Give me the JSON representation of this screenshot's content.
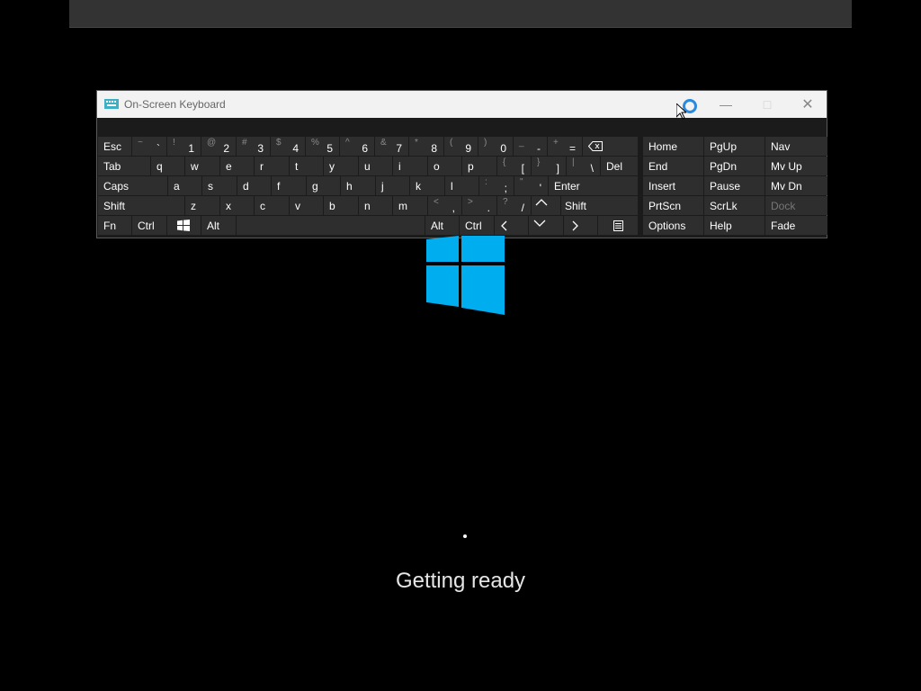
{
  "window": {
    "title": "On-Screen Keyboard",
    "controls": {
      "minimize": "minimize",
      "maximize": "maximize",
      "close": "close"
    }
  },
  "keyboard": {
    "row1": {
      "esc": "Esc",
      "digits": [
        {
          "shift": "~",
          "key": "`"
        },
        {
          "shift": "!",
          "key": "1"
        },
        {
          "shift": "@",
          "key": "2"
        },
        {
          "shift": "#",
          "key": "3"
        },
        {
          "shift": "$",
          "key": "4"
        },
        {
          "shift": "%",
          "key": "5"
        },
        {
          "shift": "^",
          "key": "6"
        },
        {
          "shift": "&",
          "key": "7"
        },
        {
          "shift": "*",
          "key": "8"
        },
        {
          "shift": "(",
          "key": "9"
        },
        {
          "shift": ")",
          "key": "0"
        },
        {
          "shift": "_",
          "key": "-"
        },
        {
          "shift": "+",
          "key": "="
        }
      ]
    },
    "row2": {
      "tab": "Tab",
      "letters": [
        "q",
        "w",
        "e",
        "r",
        "t",
        "y",
        "u",
        "i",
        "o",
        "p"
      ],
      "brackets": [
        {
          "shift": "{",
          "key": "["
        },
        {
          "shift": "}",
          "key": "]"
        },
        {
          "shift": "|",
          "key": "\\"
        }
      ],
      "del": "Del"
    },
    "row3": {
      "caps": "Caps",
      "letters": [
        "a",
        "s",
        "d",
        "f",
        "g",
        "h",
        "j",
        "k",
        "l"
      ],
      "punct": [
        {
          "shift": ":",
          "key": ";"
        },
        {
          "shift": "\"",
          "key": "'"
        }
      ],
      "enter": "Enter"
    },
    "row4": {
      "shift_left": "Shift",
      "letters": [
        "z",
        "x",
        "c",
        "v",
        "b",
        "n",
        "m"
      ],
      "punct": [
        {
          "shift": "<",
          "key": ","
        },
        {
          "shift": ">",
          "key": "."
        },
        {
          "shift": "?",
          "key": "/"
        }
      ],
      "shift_right": "Shift"
    },
    "row5": {
      "fn": "Fn",
      "ctrl_left": "Ctrl",
      "alt_left": "Alt",
      "alt_right": "Alt",
      "ctrl_right": "Ctrl"
    },
    "nav": {
      "home": "Home",
      "pgup": "PgUp",
      "nav": "Nav",
      "end": "End",
      "pgdn": "PgDn",
      "mvup": "Mv Up",
      "insert": "Insert",
      "pause": "Pause",
      "mvdn": "Mv Dn",
      "prtscn": "PrtScn",
      "scrlk": "ScrLk",
      "dock": "Dock",
      "options": "Options",
      "help": "Help",
      "fade": "Fade"
    }
  },
  "boot": {
    "status": "Getting ready"
  },
  "colors": {
    "logo_blue": "#00adef",
    "key_bg": "#2e2e2e",
    "titlebar_bg": "#f2f2f2"
  }
}
